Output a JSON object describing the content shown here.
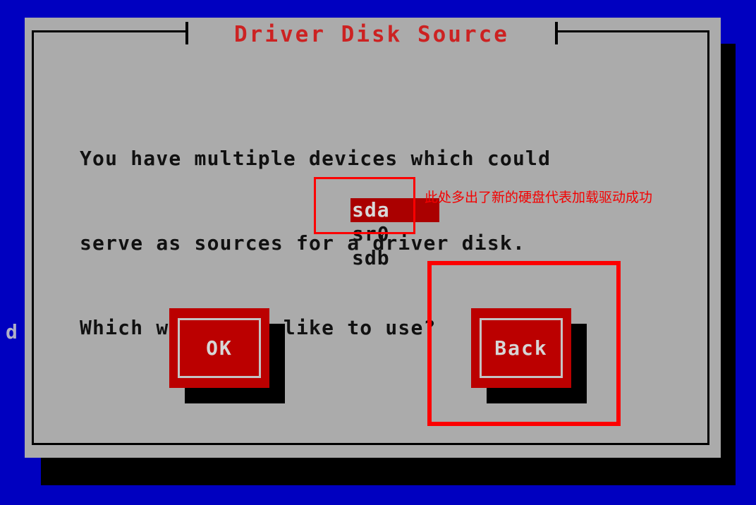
{
  "screen": {
    "background_color": "#0000c0",
    "stray_glyph": "d"
  },
  "dialog": {
    "title": "Driver Disk Source",
    "title_color": "#cc2222",
    "panel_color": "#ababab",
    "border_color": "#000000",
    "body_lines": [
      "You have multiple devices which could",
      "serve as sources for a driver disk.",
      "Which would you like to use?"
    ],
    "device_list": {
      "items": [
        {
          "label": "sda",
          "selected": true
        },
        {
          "label": "sr0",
          "selected": false
        },
        {
          "label": "sdb",
          "selected": false
        }
      ],
      "selected_background": "#aa0000",
      "selected_text_color": "#d8d8d8"
    },
    "buttons": [
      {
        "id": "ok",
        "label": "OK",
        "face_color": "#bb0000",
        "highlighted": false
      },
      {
        "id": "back",
        "label": "Back",
        "face_color": "#bb0000",
        "highlighted": true
      }
    ]
  },
  "annotations": {
    "color": "#fc0000",
    "note_text": "此处多出了新的硬盘代表加载驱动成功",
    "boxes": [
      {
        "id": "device-list-box",
        "target": "sda / sr0 list entries"
      },
      {
        "id": "back-button-box",
        "target": "Back button"
      }
    ]
  }
}
